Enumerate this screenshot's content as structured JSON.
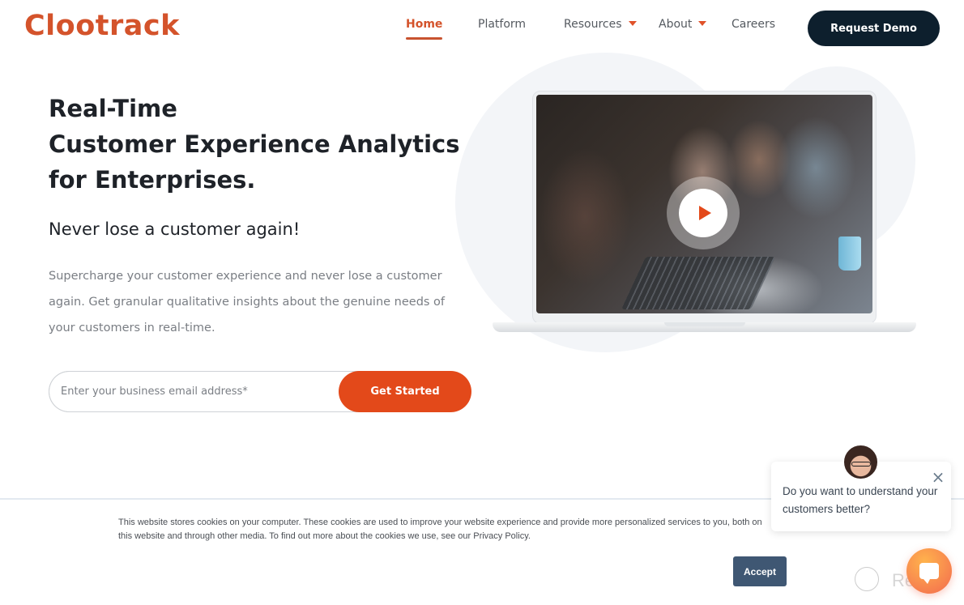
{
  "brand": {
    "logo_text": "Clootrack",
    "accent_color": "#d4532b"
  },
  "nav": {
    "items": [
      {
        "label": "Home",
        "active": true,
        "has_dropdown": false
      },
      {
        "label": "Platform",
        "active": false,
        "has_dropdown": false
      },
      {
        "label": "Resources",
        "active": false,
        "has_dropdown": true
      },
      {
        "label": "About",
        "active": false,
        "has_dropdown": true
      },
      {
        "label": "Careers",
        "active": false,
        "has_dropdown": false
      }
    ],
    "cta_label": "Request Demo",
    "cta_color": "#0d1f2d"
  },
  "hero": {
    "title_lines": [
      "Real-Time",
      "Customer Experience Analytics",
      "for Enterprises."
    ],
    "subtitle": "Never lose a customer again!",
    "description": "Supercharge your customer experience and never lose a customer again. Get granular qualitative insights about the genuine needs of your customers in real-time.",
    "email_placeholder": "Enter your business email address*",
    "email_value": "",
    "submit_label": "Get Started",
    "submit_color": "#e3491a",
    "media": {
      "type": "video",
      "play_icon": "play-icon"
    }
  },
  "cookie_banner": {
    "text": "This website stores cookies on your computer. These cookies are used to improve your website experience and provide more personalized services to you, both on this website and through other media. To find out more about the cookies we use, see our Privacy Policy.",
    "accept_label": "Accept",
    "accept_color": "#3f5773"
  },
  "chat_popup": {
    "message": "Do you want to understand your customers better?",
    "close_icon": "close-icon",
    "launcher_icon": "chat-bubble-icon"
  },
  "watermark": {
    "text": "Revain"
  }
}
